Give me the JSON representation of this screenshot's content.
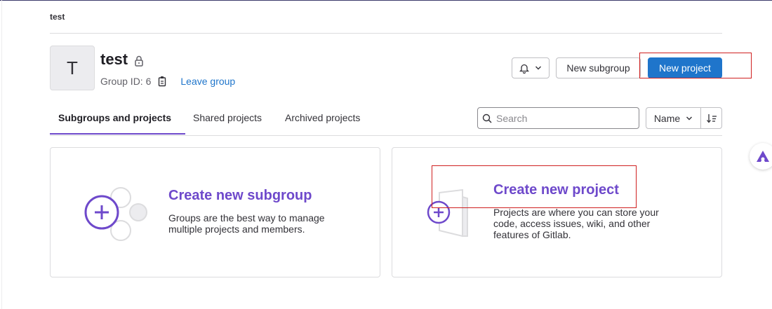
{
  "breadcrumb": "test",
  "group": {
    "avatar_letter": "T",
    "name": "test",
    "id_label": "Group ID: 6",
    "leave_label": "Leave group"
  },
  "actions": {
    "new_subgroup": "New subgroup",
    "new_project": "New project"
  },
  "tabs": [
    {
      "label": "Subgroups and projects"
    },
    {
      "label": "Shared projects"
    },
    {
      "label": "Archived projects"
    }
  ],
  "search": {
    "placeholder": "Search"
  },
  "sort": {
    "selected": "Name"
  },
  "cards": {
    "subgroup": {
      "title": "Create new subgroup",
      "description": "Groups are the best way to manage multiple projects and members."
    },
    "project": {
      "title": "Create new project",
      "description": "Projects are where you can store your code, access issues, wiki, and other features of Gitlab."
    }
  },
  "colors": {
    "accent": "#6e49cb",
    "primary": "#1f75cb",
    "highlight": "#d02020"
  },
  "icons": [
    "lock-icon",
    "copy-icon",
    "bell-icon",
    "chevron-down-icon",
    "search-icon",
    "sort-direction-icon",
    "plus-icon"
  ]
}
